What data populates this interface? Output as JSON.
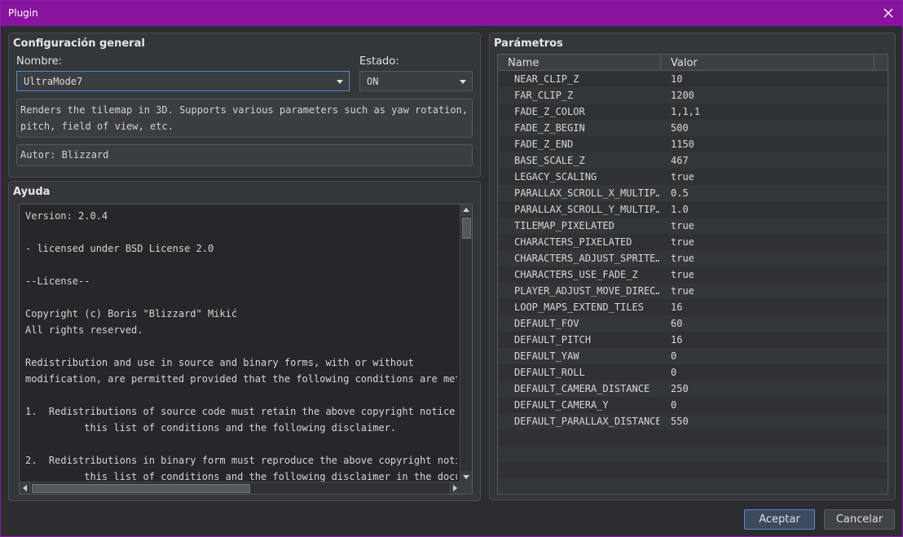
{
  "window": {
    "title": "Plugin"
  },
  "general": {
    "title": "Configuración general",
    "name_label": "Nombre:",
    "name_value": "UltraMode7",
    "status_label": "Estado:",
    "status_value": "ON",
    "description": "Renders the tilemap in 3D. Supports various parameters such as yaw rotation,\npitch, field of view, etc.",
    "author": "Autor: Blizzard"
  },
  "help": {
    "title": "Ayuda",
    "text": "Version: 2.0.4\n\n- licensed under BSD License 2.0\n\n--License--\n\nCopyright (c) Boris \"Blizzard\" Mikić\nAll rights reserved.\n\nRedistribution and use in source and binary forms, with or without\nmodification, are permitted provided that the following conditions are met:\n\n1.  Redistributions of source code must retain the above copyright notice,\n          this list of conditions and the following disclaimer.\n\n2.  Redistributions in binary form must reproduce the above copyright notice,\n          this list of conditions and the following disclaimer in the documentation"
  },
  "params": {
    "title": "Parámetros",
    "col_name": "Name",
    "col_value": "Valor",
    "rows": [
      {
        "name": "NEAR_CLIP_Z",
        "value": "10"
      },
      {
        "name": "FAR_CLIP_Z",
        "value": "1200"
      },
      {
        "name": "FADE_Z_COLOR",
        "value": "1,1,1"
      },
      {
        "name": "FADE_Z_BEGIN",
        "value": "500"
      },
      {
        "name": "FADE_Z_END",
        "value": "1150"
      },
      {
        "name": "BASE_SCALE_Z",
        "value": "467"
      },
      {
        "name": "LEGACY_SCALING",
        "value": "true"
      },
      {
        "name": "PARALLAX_SCROLL_X_MULTIP…",
        "value": "0.5"
      },
      {
        "name": "PARALLAX_SCROLL_Y_MULTIP…",
        "value": "1.0"
      },
      {
        "name": "TILEMAP_PIXELATED",
        "value": "true"
      },
      {
        "name": "CHARACTERS_PIXELATED",
        "value": "true"
      },
      {
        "name": "CHARACTERS_ADJUST_SPRITE…",
        "value": "true"
      },
      {
        "name": "CHARACTERS_USE_FADE_Z",
        "value": "true"
      },
      {
        "name": "PLAYER_ADJUST_MOVE_DIREC…",
        "value": "true"
      },
      {
        "name": "LOOP_MAPS_EXTEND_TILES",
        "value": "16"
      },
      {
        "name": "DEFAULT_FOV",
        "value": "60"
      },
      {
        "name": "DEFAULT_PITCH",
        "value": "16"
      },
      {
        "name": "DEFAULT_YAW",
        "value": "0"
      },
      {
        "name": "DEFAULT_ROLL",
        "value": "0"
      },
      {
        "name": "DEFAULT_CAMERA_DISTANCE",
        "value": "250"
      },
      {
        "name": "DEFAULT_CAMERA_Y",
        "value": "0"
      },
      {
        "name": "DEFAULT_PARALLAX_DISTANCE",
        "value": "550"
      }
    ]
  },
  "footer": {
    "ok_label": "Aceptar",
    "cancel_label": "Cancelar"
  },
  "colors": {
    "titlebar": "#88139f",
    "accent": "#5e88c8",
    "background": "#2b2d30"
  }
}
